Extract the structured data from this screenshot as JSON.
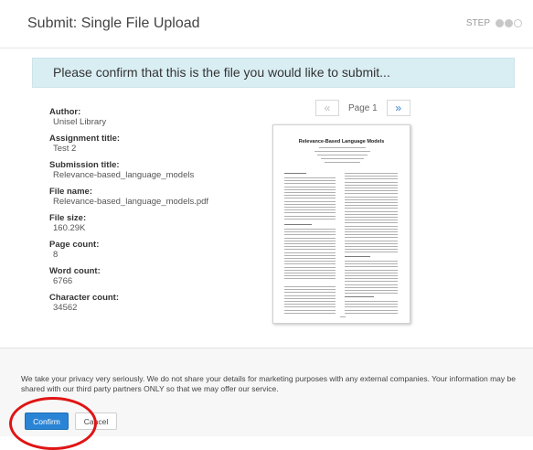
{
  "header": {
    "title": "Submit: Single File Upload",
    "step_label": "STEP"
  },
  "banner": {
    "text": "Please confirm that this is the file you would like to submit..."
  },
  "details": [
    {
      "label": "Author:",
      "value": "Unisel Library"
    },
    {
      "label": "Assignment title:",
      "value": "Test 2"
    },
    {
      "label": "Submission title:",
      "value": "Relevance-based_language_models"
    },
    {
      "label": "File name:",
      "value": "Relevance-based_language_models.pdf"
    },
    {
      "label": "File size:",
      "value": "160.29K"
    },
    {
      "label": "Page count:",
      "value": "8"
    },
    {
      "label": "Word count:",
      "value": "6766"
    },
    {
      "label": "Character count:",
      "value": "34562"
    }
  ],
  "pager": {
    "prev_icon": "«",
    "next_icon": "»",
    "page_label": "Page 1"
  },
  "preview": {
    "document_title": "Relevance-Based Language Models"
  },
  "footer": {
    "privacy_text": "We take your privacy very seriously. We do not share your details for marketing purposes with any external companies. Your information may be shared with our third party partners ONLY so that we may offer our service.",
    "confirm_label": "Confirm",
    "cancel_label": "Cancel"
  },
  "colors": {
    "banner_bg": "#d9eef3",
    "confirm_bg": "#2a84d6",
    "annotation": "#e01414"
  }
}
